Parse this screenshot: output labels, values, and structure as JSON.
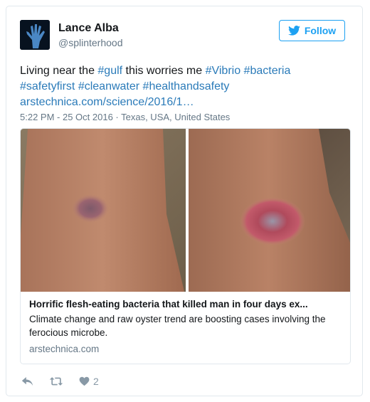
{
  "user": {
    "name": "Lance Alba",
    "handle": "@splinterhood"
  },
  "follow_label": "Follow",
  "tweet": {
    "t1": "Living near the ",
    "tag_gulf": "#gulf",
    "t2": " this worries me ",
    "tag_vibrio": "#Vibrio",
    "tag_bacteria": "#bacteria",
    "tag_safetyfirst": "#safetyfirst",
    "tag_cleanwater": "#cleanwater",
    "tag_healthandsafety": "#healthandsafety",
    "link": "arstechnica.com/science/2016/1…"
  },
  "meta": {
    "time": "5:22 PM - 25 Oct 2016",
    "sep": " · ",
    "location": "Texas, USA, United States"
  },
  "card": {
    "title": "Horrific flesh-eating bacteria that killed man in four days ex...",
    "description": "Climate change and raw oyster trend are boosting cases involving the ferocious microbe.",
    "domain": "arstechnica.com"
  },
  "actions": {
    "likes": "2"
  },
  "colors": {
    "link": "#2b7bb9",
    "follow": "#1da1f2",
    "muted": "#657786"
  },
  "icons": [
    "twitter-bird-icon",
    "reply-icon",
    "retweet-icon",
    "heart-icon"
  ]
}
